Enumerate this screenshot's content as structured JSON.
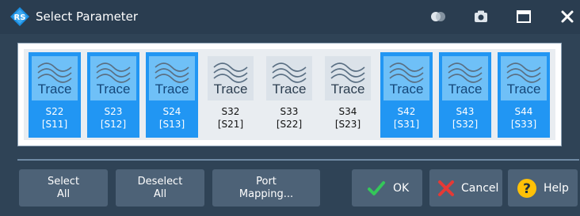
{
  "window": {
    "title": "Select Parameter"
  },
  "titlebar_icons": [
    "toggle-icon",
    "camera-icon",
    "maximize-icon",
    "close-icon"
  ],
  "trace_icon_label": "Trace",
  "parameters": [
    {
      "name": "S22",
      "alias": "[S11]",
      "selected": true
    },
    {
      "name": "S23",
      "alias": "[S12]",
      "selected": true
    },
    {
      "name": "S24",
      "alias": "[S13]",
      "selected": true
    },
    {
      "name": "S32",
      "alias": "[S21]",
      "selected": false
    },
    {
      "name": "S33",
      "alias": "[S22]",
      "selected": false
    },
    {
      "name": "S34",
      "alias": "[S23]",
      "selected": false
    },
    {
      "name": "S42",
      "alias": "[S31]",
      "selected": true
    },
    {
      "name": "S43",
      "alias": "[S32]",
      "selected": true
    },
    {
      "name": "S44",
      "alias": "[S33]",
      "selected": true
    }
  ],
  "buttons": {
    "select_all": {
      "line1": "Select",
      "line2": "All"
    },
    "deselect_all": {
      "line1": "Deselect",
      "line2": "All"
    },
    "port_mapping": {
      "line1": "Port",
      "line2": "Mapping..."
    },
    "ok": "OK",
    "cancel": "Cancel",
    "help": "Help"
  },
  "colors": {
    "selected_tile": "#2196f3",
    "ok_check": "#34c759",
    "cancel_x": "#e53935",
    "help_badge": "#ffc107"
  }
}
